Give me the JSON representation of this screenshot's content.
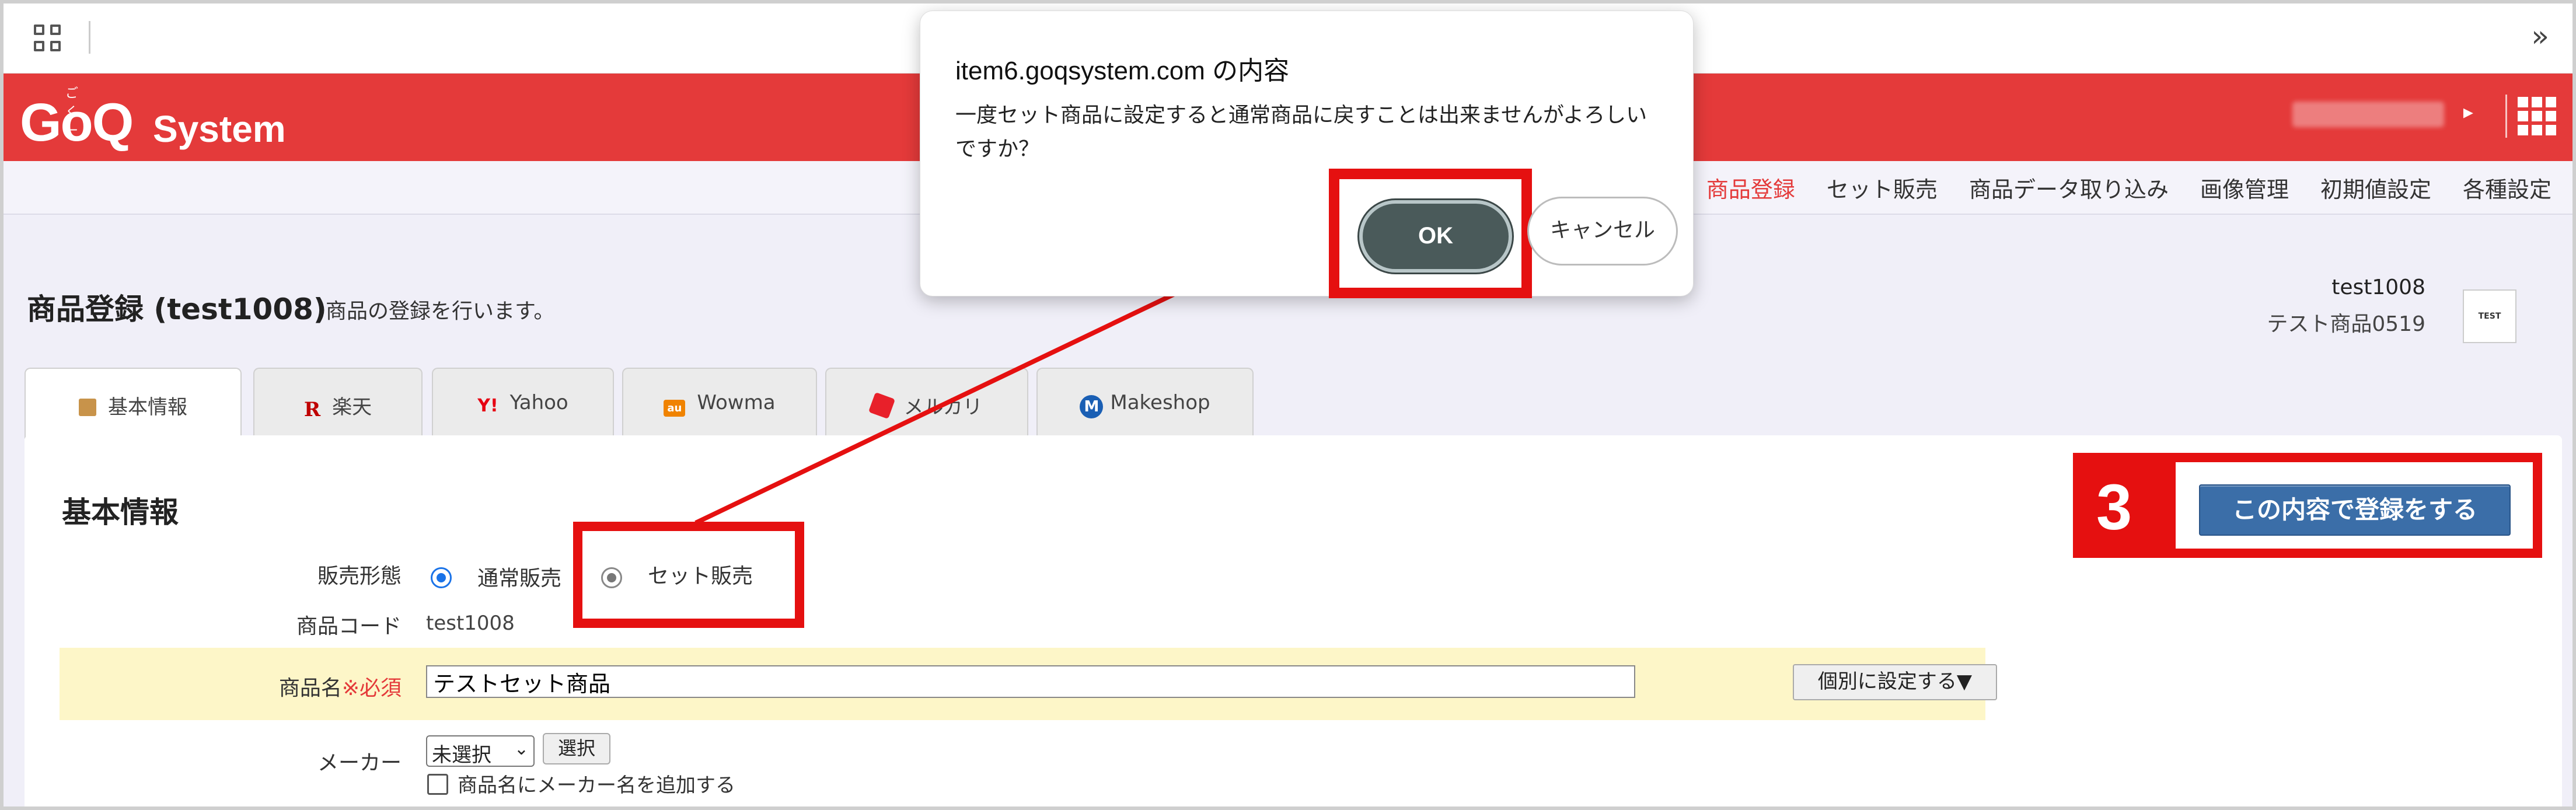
{
  "browser": {
    "more_label": "»"
  },
  "header": {
    "logo_main": "GoQ",
    "logo_ruby": "ごくー",
    "logo_sub": "System",
    "brand_color": "#e43a3a"
  },
  "nav": {
    "items": [
      {
        "label": "商品登録",
        "active": true
      },
      {
        "label": "セット販売",
        "active": false
      },
      {
        "label": "商品データ取り込み",
        "active": false
      },
      {
        "label": "画像管理",
        "active": false
      },
      {
        "label": "初期値設定",
        "active": false
      },
      {
        "label": "各種設定",
        "active": false
      }
    ]
  },
  "page": {
    "title": "商品登録 (test1008)",
    "subtitle": "商品の登録を行います。",
    "meta_code": "test1008",
    "meta_name": "テスト商品0519",
    "thumb_label": "TEST"
  },
  "tabs": [
    {
      "label": "基本情報",
      "icon": "box-icon"
    },
    {
      "label": "楽天",
      "icon": "rakuten-icon",
      "icon_text": "R"
    },
    {
      "label": "Yahoo",
      "icon": "yahoo-icon",
      "icon_text": "Y!"
    },
    {
      "label": "Wowma",
      "icon": "wowma-icon",
      "icon_text": "au"
    },
    {
      "label": "メルカリ",
      "icon": "mercari-icon"
    },
    {
      "label": "Makeshop",
      "icon": "makeshop-icon",
      "icon_text": "M"
    }
  ],
  "form": {
    "section_title": "基本情報",
    "sale_label": "販売形態",
    "sale_option_normal": "通常販売",
    "sale_option_set": "セット販売",
    "code_label": "商品コード",
    "code_value": "test1008",
    "name_label": "商品名",
    "name_required": "※必須",
    "name_value": "テストセット商品",
    "individual_button": "個別に設定する▼",
    "maker_label": "メーカー",
    "maker_select_value": "未選択",
    "maker_select_button": "選択",
    "maker_add_checkbox_label": "商品名にメーカー名を追加する"
  },
  "step": {
    "number": "3",
    "register_button": "この内容で登録をする"
  },
  "dialog": {
    "title": "item6.goqsystem.com の内容",
    "message": "一度セット商品に設定すると通常商品に戻すことは出来ませんがよろしいですか？",
    "ok_label": "OK",
    "cancel_label": "キャンセル"
  },
  "annotation_color": "#e51010"
}
